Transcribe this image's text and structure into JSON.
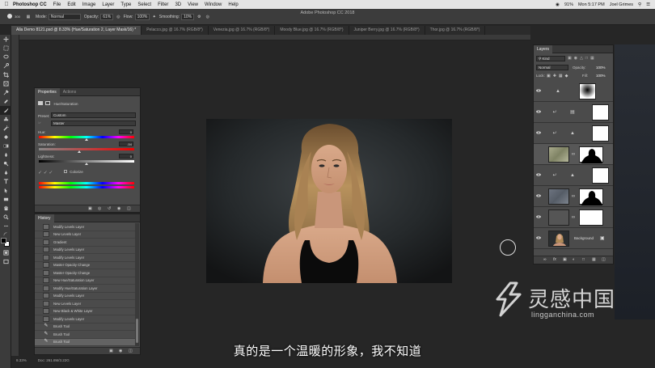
{
  "menubar": {
    "app": "Photoshop CC",
    "items": [
      "File",
      "Edit",
      "Image",
      "Layer",
      "Type",
      "Select",
      "Filter",
      "3D",
      "View",
      "Window",
      "Help"
    ],
    "battery": "91%",
    "clock": "Mon 5:17 PM",
    "user": "Joel Grimes"
  },
  "options": {
    "brush_size": "300",
    "mode_label": "Mode:",
    "mode_value": "Normal",
    "opacity_label": "Opacity:",
    "opacity_value": "61%",
    "flow_label": "Flow:",
    "flow_value": "100%",
    "smoothing_label": "Smoothing:",
    "smoothing_value": "10%",
    "window_title": "Adobe Photoshop CC 2018"
  },
  "tabs": [
    "Alla Demo 8121.psd @ 8.33% (Hue/Saturation 2, Layer Mask/16) *",
    "Pelacco.jpg @ 16.7% (RGB/8*)",
    "Venezia.jpg @ 16.7% (RGB/8*)",
    "Moody Blue.jpg @ 16.7% (RGB/8*)",
    "Juniper Berry.jpg @ 16.7% (RGB/8*)",
    "Thor.jpg @ 16.7% (RGB/8*)"
  ],
  "properties": {
    "tab_properties": "Properties",
    "tab_actions": "Actions",
    "adjustment_name": "Hue/Saturation",
    "preset_label": "Preset:",
    "preset_value": "Custom",
    "channel_value": "Master",
    "hue_label": "Hue:",
    "hue_value": "0",
    "saturation_label": "Saturation:",
    "saturation_value": "-54",
    "lightness_label": "Lightness:",
    "lightness_value": "0",
    "colorize_label": "Colorize"
  },
  "history": {
    "title": "History",
    "items": [
      {
        "label": "Modify Levels Layer",
        "type": "layer"
      },
      {
        "label": "New Levels Layer",
        "type": "layer"
      },
      {
        "label": "Gradient",
        "type": "layer"
      },
      {
        "label": "Modify Levels Layer",
        "type": "layer"
      },
      {
        "label": "Modify Levels Layer",
        "type": "layer"
      },
      {
        "label": "Master Opacity Change",
        "type": "layer"
      },
      {
        "label": "Master Opacity Change",
        "type": "layer"
      },
      {
        "label": "New Hue/Saturation Layer",
        "type": "layer"
      },
      {
        "label": "Modify Hue/Saturation Layer",
        "type": "layer"
      },
      {
        "label": "Modify Levels Layer",
        "type": "layer"
      },
      {
        "label": "New Levels Layer",
        "type": "layer"
      },
      {
        "label": "New Black & White Layer",
        "type": "layer"
      },
      {
        "label": "Modify Levels Layer",
        "type": "layer"
      },
      {
        "label": "Brush Tool",
        "type": "brush"
      },
      {
        "label": "Brush Tool",
        "type": "brush"
      },
      {
        "label": "Brush Tool",
        "type": "brush",
        "current": true
      }
    ]
  },
  "layers": {
    "title": "Layers",
    "filter_label": "Kind",
    "blend_mode": "Normal",
    "opacity_label": "Opacity:",
    "opacity_value": "100%",
    "lock_label": "Lock:",
    "fill_label": "Fill:",
    "fill_value": "100%",
    "background_name": "Background"
  },
  "status": {
    "zoom": "8.33%",
    "doc": "Doc: 261.8M/3.22G"
  },
  "subtitle": "真的是一个温暖的形象，我不知道",
  "watermark": {
    "cn": "灵感中国",
    "en": "lingganchina.com"
  }
}
